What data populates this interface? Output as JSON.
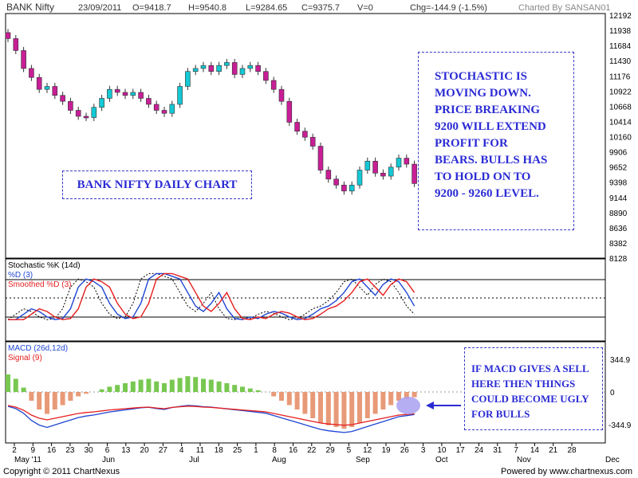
{
  "header": {
    "symbol": "BANK Nifty",
    "date": "23/09/2011",
    "open": "O=9418.7",
    "high": "H=9540.8",
    "low": "L=9284.65",
    "close": "C=9375.7",
    "volume": "V=0",
    "change": "Chg=-144.9 (-1.5%)",
    "credit": "Charted By SANSAN01"
  },
  "annotations": {
    "stochastic_note": "STOCHASTIC IS\nMOVING DOWN.\nPRICE BREAKING\n9200 WILL EXTEND\nPROFIT FOR\nBEARS. BULLS HAS\nTO HOLD ON TO\n9200 - 9260 LEVEL.",
    "chart_title": "BANK NIFTY DAILY CHART",
    "macd_note": "IF MACD GIVES A SELL\nHERE THEN THINGS\nCOULD BECOME UGLY\nFOR BULLS"
  },
  "footer": {
    "copyright": "Copyright © 2011 ChartNexus",
    "powered": "Powered by www.chartnexus.com"
  },
  "colors": {
    "up_candle": "#14c8d4",
    "down_candle": "#c81e96",
    "stoch_k": "#1e46d2",
    "stoch_d": "#e61e1e",
    "note_text": "#2b2bd4",
    "histogram_pos": "#78c850",
    "histogram_neg": "#e89a78"
  },
  "chart_data": [
    {
      "type": "candlestick",
      "title": "BANK Nifty",
      "y_ticks": [
        12192,
        11938,
        11684,
        11430,
        11176,
        10922,
        10668,
        10414,
        10160,
        9906,
        9652,
        9398,
        9144,
        8890,
        8636,
        8382,
        8128
      ],
      "ylim": [
        8128,
        12192
      ],
      "x_tick_labels": [
        "2",
        "9",
        "16",
        "23",
        "30",
        "6",
        "13",
        "20",
        "27",
        "4",
        "11",
        "18",
        "25",
        "1",
        "8",
        "16",
        "22",
        "29",
        "5",
        "12",
        "19",
        "26",
        "3",
        "10",
        "17",
        "24",
        "31",
        "7",
        "14",
        "21",
        "28"
      ],
      "month_labels": [
        "May '11",
        "Jun",
        "Jul",
        "Aug",
        "Sep",
        "Oct",
        "Nov",
        "Dec"
      ],
      "close_series": [
        11800,
        11600,
        11300,
        11150,
        10950,
        11000,
        10850,
        10750,
        10600,
        10500,
        10480,
        10650,
        10800,
        10950,
        10900,
        10850,
        10900,
        10800,
        10700,
        10600,
        10550,
        10700,
        11000,
        11250,
        11300,
        11350,
        11250,
        11350,
        11400,
        11200,
        11300,
        11350,
        11250,
        11100,
        10950,
        10750,
        10400,
        10250,
        10150,
        10000,
        9600,
        9450,
        9350,
        9250,
        9350,
        9600,
        9750,
        9550,
        9500,
        9650,
        9800,
        9700,
        9375.7
      ]
    },
    {
      "type": "line",
      "title": "Stochastic %K (14d)",
      "series_labels": [
        "Stochastic %K (14d)",
        "%D (3)",
        "Smoothed %D (3)"
      ]
    },
    {
      "type": "bar+line",
      "title": "MACD (26d,12d)",
      "series_labels": [
        "MACD (26d,12d)",
        "Signal (9)"
      ],
      "y_ticks": [
        344.9,
        0,
        -344.9
      ]
    }
  ]
}
